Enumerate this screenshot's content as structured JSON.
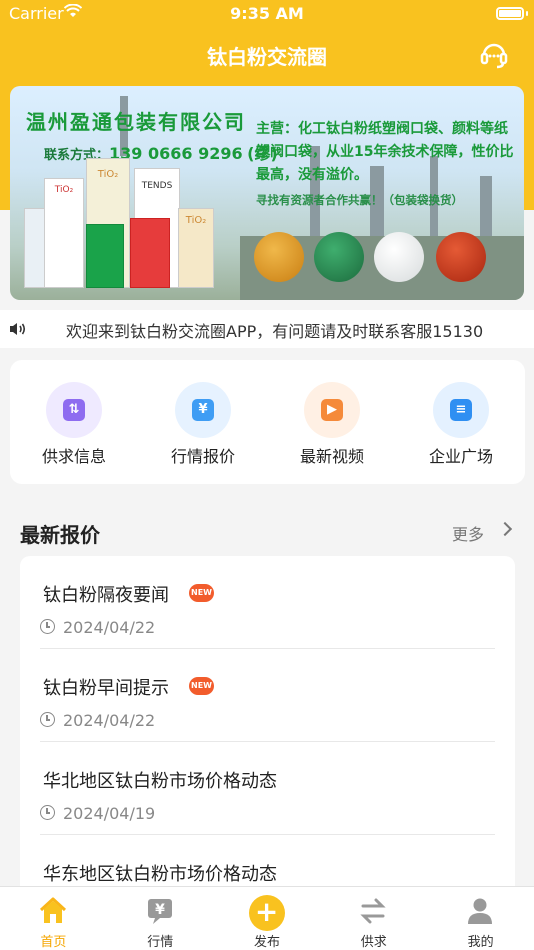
{
  "status_bar": {
    "carrier": "Carrier",
    "time": "9:35 AM"
  },
  "nav": {
    "title": "钛白粉交流圈"
  },
  "banner": {
    "company": "温州盈通包装有限公司",
    "contact_label": "联系方式：",
    "contact_number": "139 0666 9296",
    "contact_name": "(缪)",
    "main_business": "主营：化工钛白粉纸塑阀口袋、颜料等纸塑阀口袋，从业15年余技术保障，性价比最高，没有溢价。",
    "cooperation": "寻找有资源者合作共赢！（包装袋换货）",
    "bag_labels": [
      "TiO₂",
      "TiO₂",
      "TENDS",
      "TiO₂"
    ]
  },
  "announcement": {
    "text": "欢迎来到钛白粉交流圈APP，有问题请及时联系客服15130"
  },
  "menu": [
    {
      "label": "供求信息",
      "icon": "supply-demand-icon",
      "color": "#8e6cf0",
      "bg": "#efeaff"
    },
    {
      "label": "行情报价",
      "icon": "price-quote-icon",
      "color": "#3f9df4",
      "bg": "#e6f2ff"
    },
    {
      "label": "最新视频",
      "icon": "video-icon",
      "color": "#f58a3a",
      "bg": "#fff0e4"
    },
    {
      "label": "企业广场",
      "icon": "enterprise-icon",
      "color": "#2f8ff2",
      "bg": "#e4f1ff"
    }
  ],
  "latest": {
    "title": "最新报价",
    "more": "更多",
    "items": [
      {
        "title": "钛白粉隔夜要闻",
        "date": "2024/04/22",
        "badge": "NEW"
      },
      {
        "title": "钛白粉早间提示",
        "date": "2024/04/22",
        "badge": "NEW"
      },
      {
        "title": "华北地区钛白粉市场价格动态",
        "date": "2024/04/19",
        "badge": ""
      },
      {
        "title": "华东地区钛白粉市场价格动态",
        "date": "",
        "badge": ""
      }
    ]
  },
  "tabbar": [
    {
      "label": "首页",
      "icon": "home-icon",
      "active": true
    },
    {
      "label": "行情",
      "icon": "market-icon",
      "active": false
    },
    {
      "label": "发布",
      "icon": "publish-plus-icon",
      "active": false
    },
    {
      "label": "供求",
      "icon": "exchange-icon",
      "active": false
    },
    {
      "label": "我的",
      "icon": "profile-icon",
      "active": false
    }
  ],
  "colors": {
    "brand": "#f9c21f",
    "accent": "#f5a600",
    "badge": "#f25c2c"
  }
}
